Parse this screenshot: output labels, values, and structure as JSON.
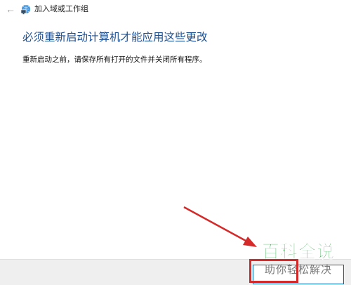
{
  "window": {
    "title": "加入域或工作组"
  },
  "icons": {
    "back": "back-arrow-icon",
    "app": "network-computer-icon"
  },
  "main": {
    "heading": "必须重新启动计算机才能应用这些更改",
    "message": "重新启动之前，请保存所有打开的文件并关闭所有程序。"
  },
  "watermark": {
    "line1": "百科全说",
    "line2": "助你轻松解决"
  },
  "colors": {
    "heading": "#1d4f91",
    "annotation": "#d42a2a",
    "watermark": "#20a53a",
    "button_border": "#0067c0"
  }
}
